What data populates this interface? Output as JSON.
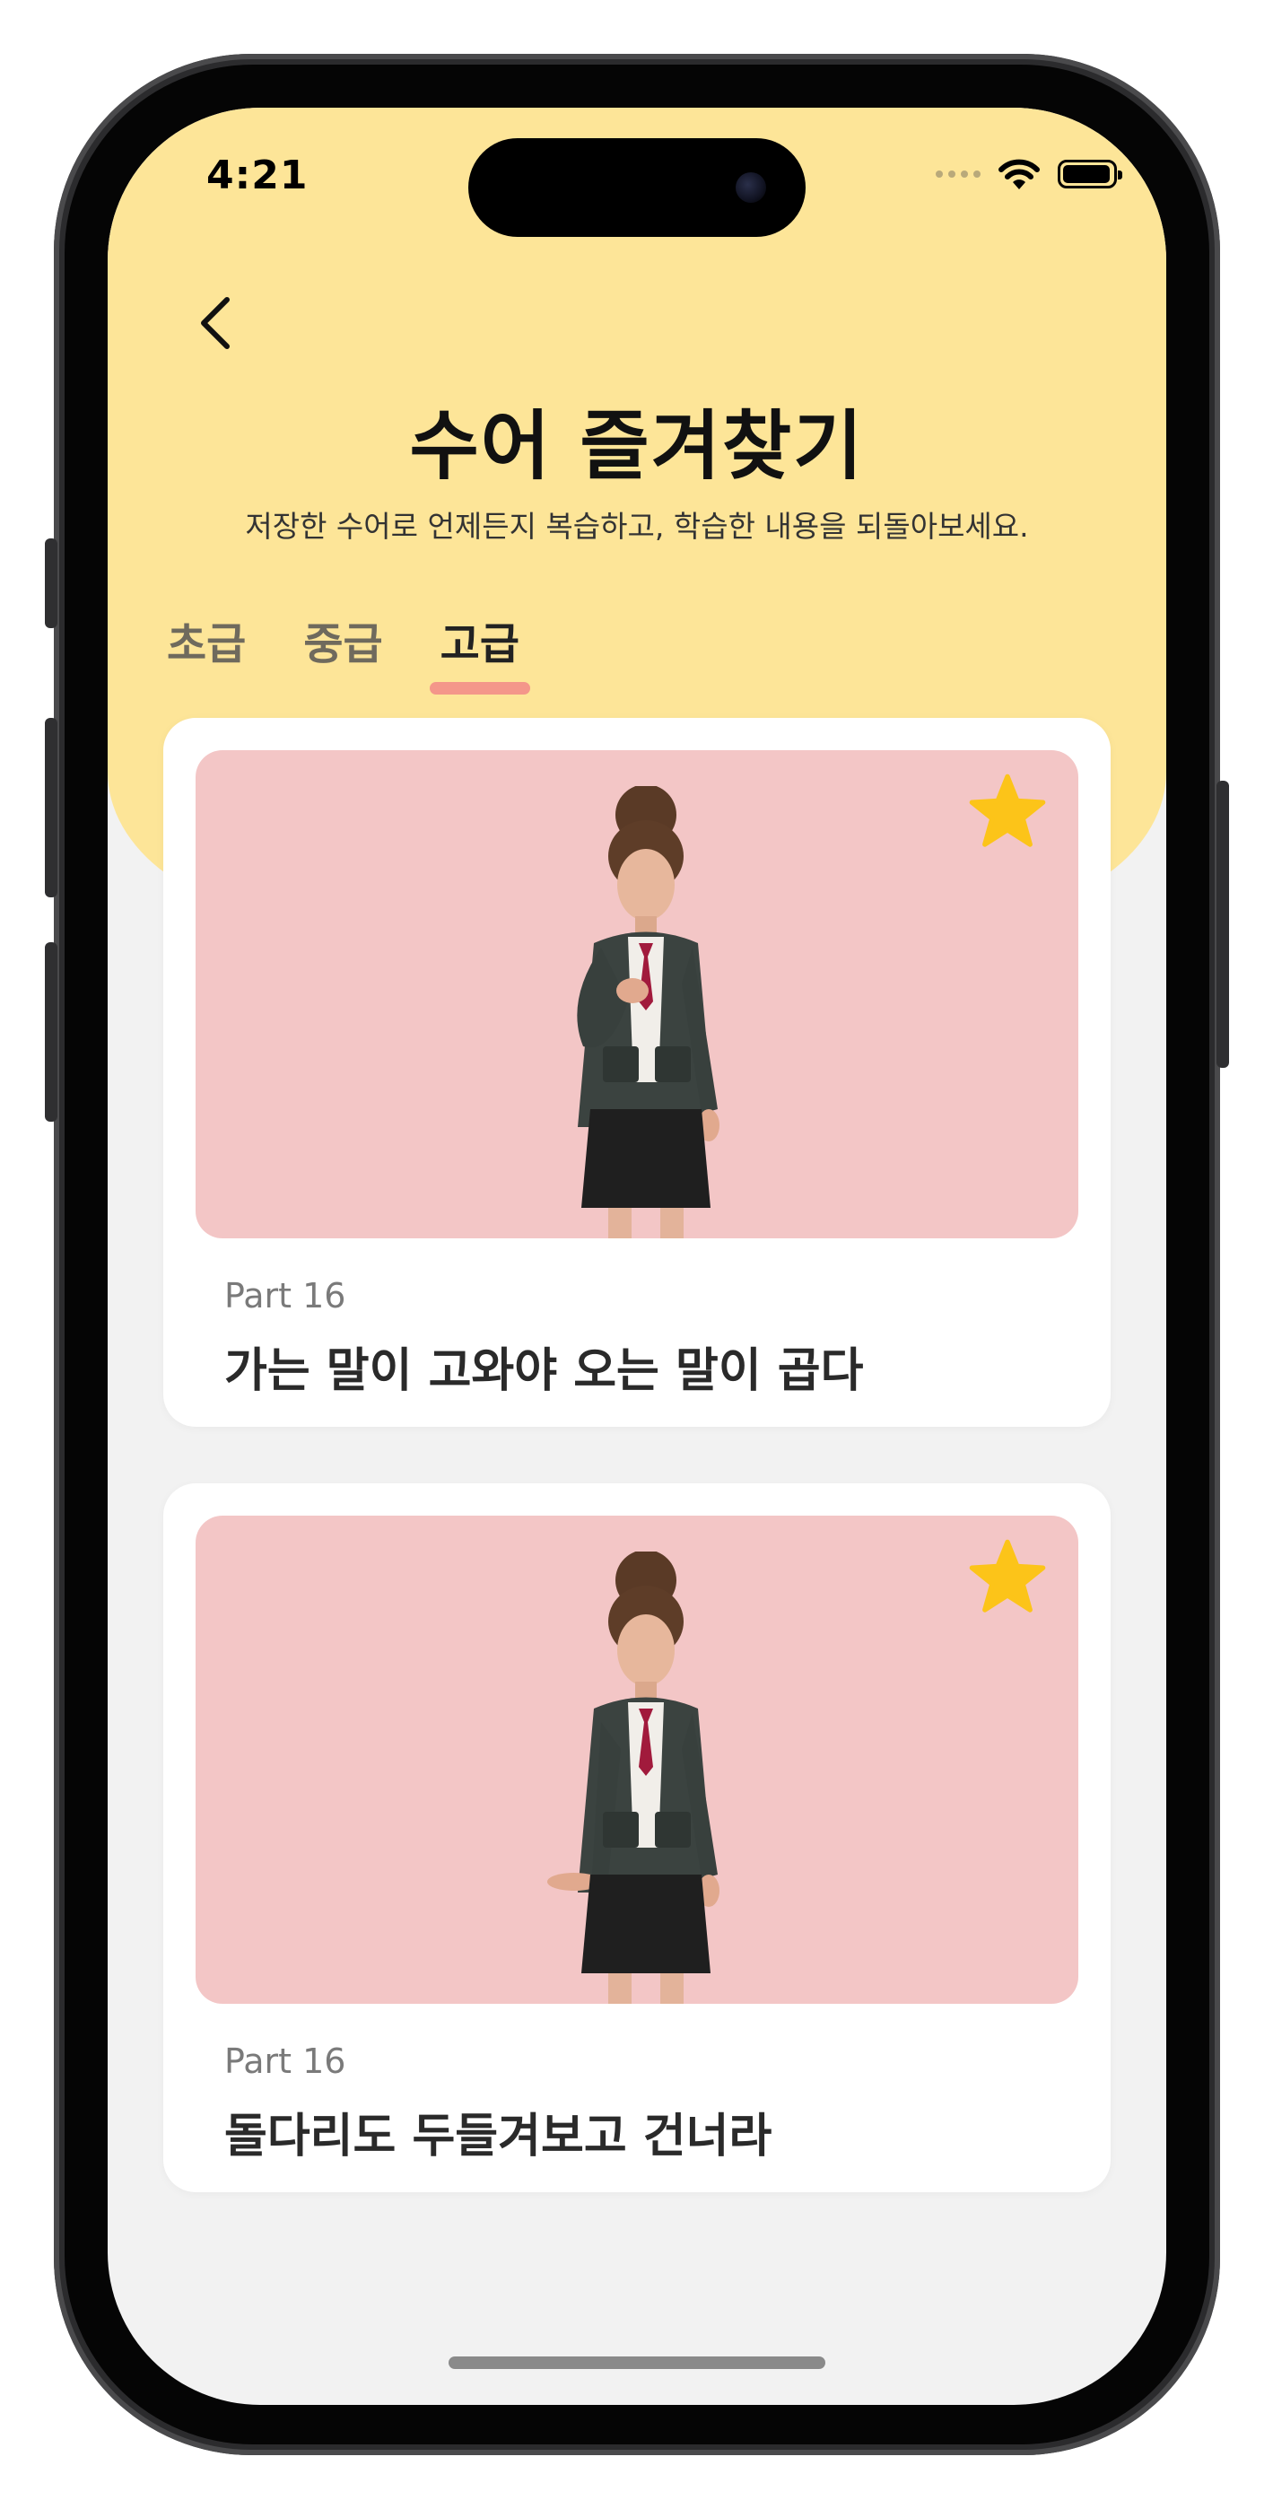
{
  "status_bar": {
    "time": "4:21",
    "icons": [
      "signal-icon",
      "wifi-icon",
      "battery-icon"
    ]
  },
  "header": {
    "back_icon": "chevron-left-icon",
    "title": "수어 즐겨찾기",
    "subtitle": "저장한 수어로 언제든지 복습하고, 학습한 내용을 되돌아보세요."
  },
  "tabs": [
    {
      "label": "초급",
      "active": false
    },
    {
      "label": "중급",
      "active": false
    },
    {
      "label": "고급",
      "active": true
    }
  ],
  "cards": [
    {
      "part": "Part 16",
      "title": "가는 말이 고와야 오는 말이 곱다",
      "favorite": true
    },
    {
      "part": "Part 16",
      "title": "돌다리도 두들겨보고 건너라",
      "favorite": true
    }
  ],
  "colors": {
    "header_bg": "#fde598",
    "tab_indicator": "#f4968a",
    "media_bg": "#f3c6c6",
    "star": "#fcc419",
    "page_bg": "#f2f2f2"
  }
}
